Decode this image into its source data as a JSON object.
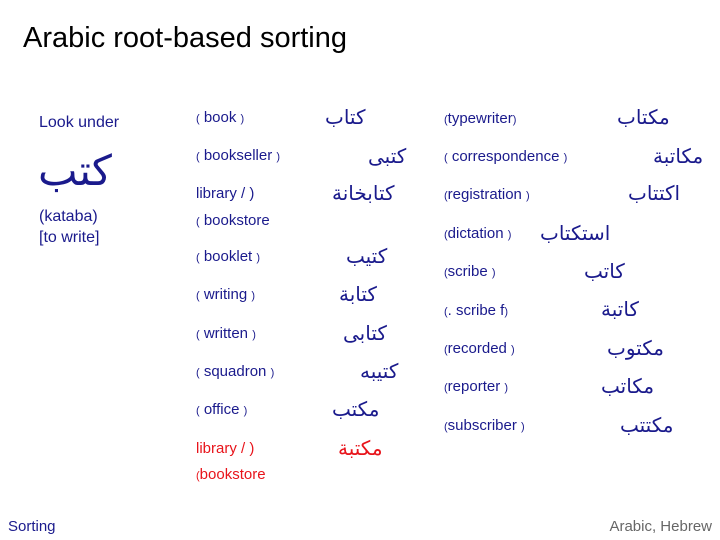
{
  "title": "Arabic root-based sorting",
  "look_under": {
    "label": "Look under",
    "word": "كتب",
    "translit": "(kataba)",
    "meaning": "[to write]"
  },
  "left_column": [
    {
      "en": "book",
      "ar": "كتاب"
    },
    {
      "en": "bookseller",
      "ar": "كتبى"
    },
    {
      "en": "library / bookstore",
      "ar": "كتابخانة",
      "en_line1": "library / )",
      "en_line2": "bookstore"
    },
    {
      "en": "booklet",
      "ar": "كتيب"
    },
    {
      "en": "writing",
      "ar": "كتابة"
    },
    {
      "en": "written",
      "ar": "كتابى"
    },
    {
      "en": "squadron",
      "ar": "كتيبه"
    },
    {
      "en": "office",
      "ar": "مكتب"
    },
    {
      "en": "library / bookstore",
      "ar": "مكتبة",
      "en_line1": "library / )",
      "en_line2": "bookstore",
      "highlight": true
    }
  ],
  "right_column": [
    {
      "en": "typewriter",
      "ar": "مكتاب"
    },
    {
      "en": "correspondence",
      "ar": "مكاتبة"
    },
    {
      "en": "registration",
      "ar": "اكتتاب"
    },
    {
      "en": "dictation",
      "ar": "استكتاب"
    },
    {
      "en": "scribe",
      "ar": "كاتب"
    },
    {
      "en": "scribe f.",
      "ar": "كاتبة",
      "en_display": ". scribe f"
    },
    {
      "en": "recorded",
      "ar": "مكتوب"
    },
    {
      "en": "reporter",
      "ar": "مكاتب"
    },
    {
      "en": "subscriber",
      "ar": "مكتتب"
    }
  ],
  "footer": {
    "left": "Sorting",
    "right": "Arabic, Hebrew"
  },
  "colors": {
    "text": "#1a1a8c",
    "highlight": "#e8141b",
    "title": "#000000",
    "footer_right": "#666666"
  }
}
